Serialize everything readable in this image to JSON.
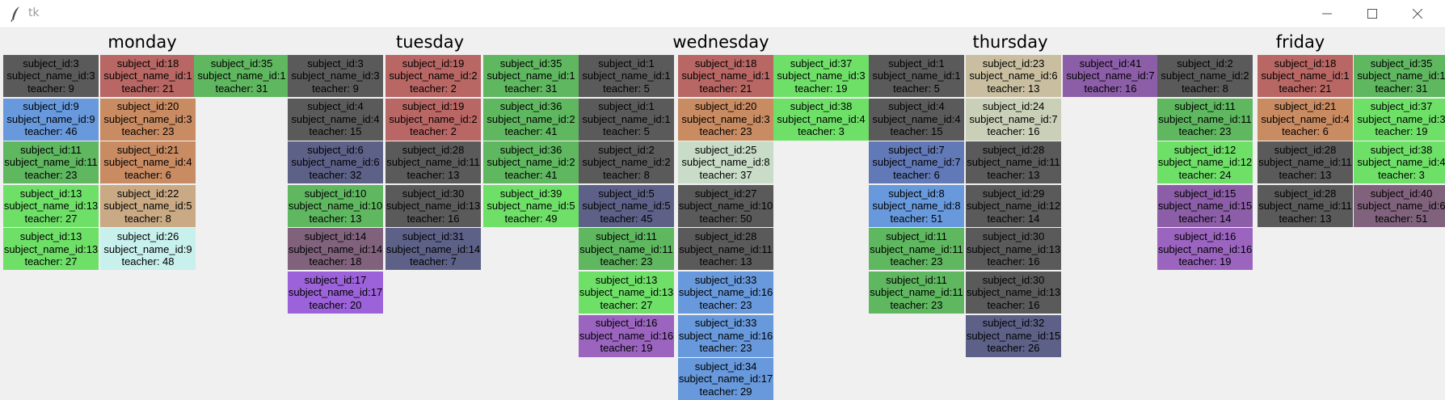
{
  "window": {
    "title": "tk"
  },
  "days": [
    "monday",
    "tuesday",
    "wednesday",
    "thursday",
    "friday"
  ],
  "colors": {
    "gray": "#5a5a5a",
    "red": "#b96764",
    "blue": "#6799dc",
    "green": "#5fb760",
    "lgreen": "#6ee068",
    "orange": "#c98b62",
    "tan": "#c9aa85",
    "cyan": "#c8f0ec",
    "slate": "#5d6187",
    "mauve": "#80627c",
    "purple": "#9c62d9",
    "lpurple": "#9a64bf",
    "sage": "#c8dcc8",
    "beige": "#c9bea0",
    "olive": "#cad0b8",
    "vpurple": "#8c5ea8",
    "steel": "#6279b8"
  },
  "columns": [
    {
      "cells": [
        {
          "subject": "subject_id:3",
          "name": "subject_name_id:3",
          "teacher": "teacher: 9",
          "color": "gray"
        },
        {
          "subject": "subject_id:9",
          "name": "subject_name_id:9",
          "teacher": "teacher: 46",
          "color": "blue"
        },
        {
          "subject": "subject_id:11",
          "name": "subject_name_id:11",
          "teacher": "teacher: 23",
          "color": "green"
        },
        {
          "subject": "subject_id:13",
          "name": "subject_name_id:13",
          "teacher": "teacher: 27",
          "color": "lgreen"
        },
        {
          "subject": "subject_id:13",
          "name": "subject_name_id:13",
          "teacher": "teacher: 27",
          "color": "lgreen"
        }
      ]
    },
    {
      "cells": [
        {
          "subject": "subject_id:18",
          "name": "subject_name_id:1",
          "teacher": "teacher: 21",
          "color": "red"
        },
        {
          "subject": "subject_id:20",
          "name": "subject_name_id:3",
          "teacher": "teacher: 23",
          "color": "orange"
        },
        {
          "subject": "subject_id:21",
          "name": "subject_name_id:4",
          "teacher": "teacher: 6",
          "color": "orange"
        },
        {
          "subject": "subject_id:22",
          "name": "subject_name_id:5",
          "teacher": "teacher: 8",
          "color": "tan"
        },
        {
          "subject": "subject_id:26",
          "name": "subject_name_id:9",
          "teacher": "teacher: 48",
          "color": "cyan"
        }
      ]
    },
    {
      "cells": [
        {
          "subject": "subject_id:35",
          "name": "subject_name_id:1",
          "teacher": "teacher: 31",
          "color": "green"
        }
      ]
    },
    {
      "cells": [
        {
          "subject": "subject_id:3",
          "name": "subject_name_id:3",
          "teacher": "teacher: 9",
          "color": "gray"
        },
        {
          "subject": "subject_id:4",
          "name": "subject_name_id:4",
          "teacher": "teacher: 15",
          "color": "gray"
        },
        {
          "subject": "subject_id:6",
          "name": "subject_name_id:6",
          "teacher": "teacher: 32",
          "color": "slate"
        },
        {
          "subject": "subject_id:10",
          "name": "subject_name_id:10",
          "teacher": "teacher: 13",
          "color": "green"
        },
        {
          "subject": "subject_id:14",
          "name": "subject_name_id:14",
          "teacher": "teacher: 18",
          "color": "mauve"
        },
        {
          "subject": "subject_id:17",
          "name": "subject_name_id:17",
          "teacher": "teacher: 20",
          "color": "purple"
        }
      ]
    },
    {
      "cells": [
        {
          "subject": "subject_id:19",
          "name": "subject_name_id:2",
          "teacher": "teacher: 2",
          "color": "red"
        },
        {
          "subject": "subject_id:19",
          "name": "subject_name_id:2",
          "teacher": "teacher: 2",
          "color": "red"
        },
        {
          "subject": "subject_id:28",
          "name": "subject_name_id:11",
          "teacher": "teacher: 13",
          "color": "gray"
        },
        {
          "subject": "subject_id:30",
          "name": "subject_name_id:13",
          "teacher": "teacher: 16",
          "color": "gray"
        },
        {
          "subject": "subject_id:31",
          "name": "subject_name_id:14",
          "teacher": "teacher: 7",
          "color": "slate"
        }
      ]
    },
    {
      "cells": [
        {
          "subject": "subject_id:35",
          "name": "subject_name_id:1",
          "teacher": "teacher: 31",
          "color": "green"
        },
        {
          "subject": "subject_id:36",
          "name": "subject_name_id:2",
          "teacher": "teacher: 41",
          "color": "green"
        },
        {
          "subject": "subject_id:36",
          "name": "subject_name_id:2",
          "teacher": "teacher: 41",
          "color": "green"
        },
        {
          "subject": "subject_id:39",
          "name": "subject_name_id:5",
          "teacher": "teacher: 49",
          "color": "lgreen"
        }
      ]
    },
    {
      "cells": [
        {
          "subject": "subject_id:1",
          "name": "subject_name_id:1",
          "teacher": "teacher: 5",
          "color": "gray"
        },
        {
          "subject": "subject_id:1",
          "name": "subject_name_id:1",
          "teacher": "teacher: 5",
          "color": "gray"
        },
        {
          "subject": "subject_id:2",
          "name": "subject_name_id:2",
          "teacher": "teacher: 8",
          "color": "gray"
        },
        {
          "subject": "subject_id:5",
          "name": "subject_name_id:5",
          "teacher": "teacher: 45",
          "color": "slate"
        },
        {
          "subject": "subject_id:11",
          "name": "subject_name_id:11",
          "teacher": "teacher: 23",
          "color": "green"
        },
        {
          "subject": "subject_id:13",
          "name": "subject_name_id:13",
          "teacher": "teacher: 27",
          "color": "lgreen"
        },
        {
          "subject": "subject_id:16",
          "name": "subject_name_id:16",
          "teacher": "teacher: 19",
          "color": "lpurple"
        }
      ]
    },
    {
      "cells": [
        {
          "subject": "subject_id:18",
          "name": "subject_name_id:1",
          "teacher": "teacher: 21",
          "color": "red"
        },
        {
          "subject": "subject_id:20",
          "name": "subject_name_id:3",
          "teacher": "teacher: 23",
          "color": "orange"
        },
        {
          "subject": "subject_id:25",
          "name": "subject_name_id:8",
          "teacher": "teacher: 37",
          "color": "sage"
        },
        {
          "subject": "subject_id:27",
          "name": "subject_name_id:10",
          "teacher": "teacher: 50",
          "color": "gray"
        },
        {
          "subject": "subject_id:28",
          "name": "subject_name_id:11",
          "teacher": "teacher: 13",
          "color": "gray"
        },
        {
          "subject": "subject_id:33",
          "name": "subject_name_id:16",
          "teacher": "teacher: 23",
          "color": "blue"
        },
        {
          "subject": "subject_id:33",
          "name": "subject_name_id:16",
          "teacher": "teacher: 23",
          "color": "blue"
        },
        {
          "subject": "subject_id:34",
          "name": "subject_name_id:17",
          "teacher": "teacher: 29",
          "color": "blue"
        }
      ]
    },
    {
      "cells": [
        {
          "subject": "subject_id:37",
          "name": "subject_name_id:3",
          "teacher": "teacher: 19",
          "color": "lgreen"
        },
        {
          "subject": "subject_id:38",
          "name": "subject_name_id:4",
          "teacher": "teacher: 3",
          "color": "lgreen"
        }
      ]
    },
    {
      "cells": [
        {
          "subject": "subject_id:1",
          "name": "subject_name_id:1",
          "teacher": "teacher: 5",
          "color": "gray"
        },
        {
          "subject": "subject_id:4",
          "name": "subject_name_id:4",
          "teacher": "teacher: 15",
          "color": "gray"
        },
        {
          "subject": "subject_id:7",
          "name": "subject_name_id:7",
          "teacher": "teacher: 6",
          "color": "steel"
        },
        {
          "subject": "subject_id:8",
          "name": "subject_name_id:8",
          "teacher": "teacher: 51",
          "color": "blue"
        },
        {
          "subject": "subject_id:11",
          "name": "subject_name_id:11",
          "teacher": "teacher: 23",
          "color": "green"
        },
        {
          "subject": "subject_id:11",
          "name": "subject_name_id:11",
          "teacher": "teacher: 23",
          "color": "green"
        }
      ]
    },
    {
      "cells": [
        {
          "subject": "subject_id:23",
          "name": "subject_name_id:6",
          "teacher": "teacher: 13",
          "color": "beige"
        },
        {
          "subject": "subject_id:24",
          "name": "subject_name_id:7",
          "teacher": "teacher: 16",
          "color": "olive"
        },
        {
          "subject": "subject_id:28",
          "name": "subject_name_id:11",
          "teacher": "teacher: 13",
          "color": "gray"
        },
        {
          "subject": "subject_id:29",
          "name": "subject_name_id:12",
          "teacher": "teacher: 14",
          "color": "gray"
        },
        {
          "subject": "subject_id:30",
          "name": "subject_name_id:13",
          "teacher": "teacher: 16",
          "color": "gray"
        },
        {
          "subject": "subject_id:30",
          "name": "subject_name_id:13",
          "teacher": "teacher: 16",
          "color": "gray"
        },
        {
          "subject": "subject_id:32",
          "name": "subject_name_id:15",
          "teacher": "teacher: 26",
          "color": "slate"
        }
      ]
    },
    {
      "cells": [
        {
          "subject": "subject_id:41",
          "name": "subject_name_id:7",
          "teacher": "teacher: 16",
          "color": "vpurple"
        }
      ]
    },
    {
      "cells": [
        {
          "subject": "subject_id:2",
          "name": "subject_name_id:2",
          "teacher": "teacher: 8",
          "color": "gray"
        },
        {
          "subject": "subject_id:11",
          "name": "subject_name_id:11",
          "teacher": "teacher: 23",
          "color": "green"
        },
        {
          "subject": "subject_id:12",
          "name": "subject_name_id:12",
          "teacher": "teacher: 24",
          "color": "lgreen"
        },
        {
          "subject": "subject_id:15",
          "name": "subject_name_id:15",
          "teacher": "teacher: 14",
          "color": "vpurple"
        },
        {
          "subject": "subject_id:16",
          "name": "subject_name_id:16",
          "teacher": "teacher: 19",
          "color": "lpurple"
        }
      ]
    },
    {
      "cells": [
        {
          "subject": "subject_id:18",
          "name": "subject_name_id:1",
          "teacher": "teacher: 21",
          "color": "red"
        },
        {
          "subject": "subject_id:21",
          "name": "subject_name_id:4",
          "teacher": "teacher: 6",
          "color": "orange"
        },
        {
          "subject": "subject_id:28",
          "name": "subject_name_id:11",
          "teacher": "teacher: 13",
          "color": "gray"
        },
        {
          "subject": "subject_id:28",
          "name": "subject_name_id:11",
          "teacher": "teacher: 13",
          "color": "gray"
        }
      ]
    },
    {
      "cells": [
        {
          "subject": "subject_id:35",
          "name": "subject_name_id:1",
          "teacher": "teacher: 31",
          "color": "green"
        },
        {
          "subject": "subject_id:37",
          "name": "subject_name_id:3",
          "teacher": "teacher: 19",
          "color": "lgreen"
        },
        {
          "subject": "subject_id:38",
          "name": "subject_name_id:4",
          "teacher": "teacher: 3",
          "color": "lgreen"
        },
        {
          "subject": "subject_id:40",
          "name": "subject_name_id:6",
          "teacher": "teacher: 51",
          "color": "mauve"
        }
      ]
    }
  ]
}
